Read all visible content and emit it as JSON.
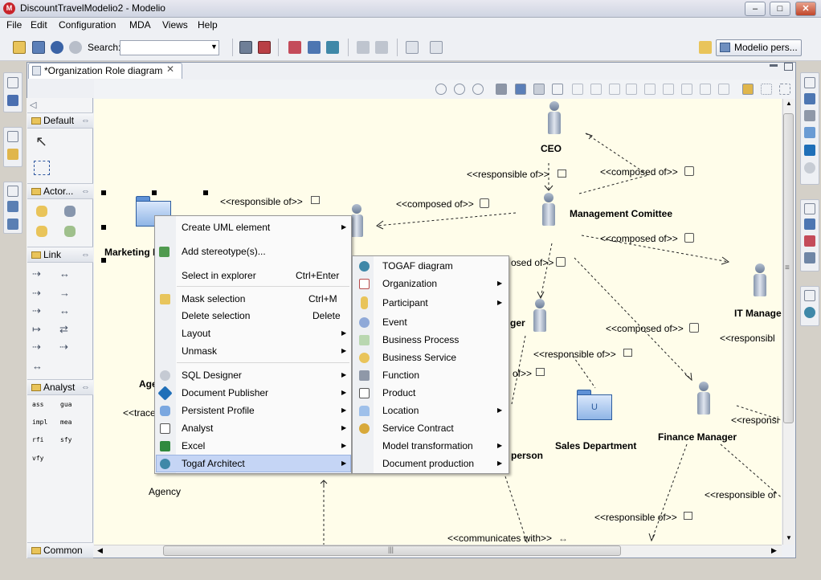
{
  "window": {
    "title": "DiscountTravelModelio2 - Modelio",
    "app_icon": "M"
  },
  "window_controls": {
    "minimize": "–",
    "maximize": "□",
    "close": "✕"
  },
  "menu": [
    "File",
    "Edit",
    "Configuration",
    "MDA",
    "Views",
    "Help"
  ],
  "toolbar": {
    "search_label": "Search:",
    "search_value": "",
    "perspective_label": "Modelio pers..."
  },
  "editor": {
    "tab_label": "*Organization Role diagram",
    "tab_close": "✕"
  },
  "palette": {
    "collapse_arrow": "◁",
    "groups": [
      {
        "label": "Default",
        "expand": "⇔"
      },
      {
        "label": "Actor...",
        "expand": "⇔"
      },
      {
        "label": "Link",
        "expand": "⇔"
      },
      {
        "label": "Analyst",
        "expand": "⇔"
      },
      {
        "label": "Common"
      }
    ],
    "stereotype_tools": [
      "ass",
      "gua",
      "impl",
      "mea",
      "rfi",
      "sfy",
      "vfy"
    ]
  },
  "diagram": {
    "nodes": {
      "ceo": "CEO",
      "management": "Management Comittee",
      "it_manager": "IT Manage",
      "finance": "Finance Manager",
      "sales": "Sales Department",
      "marketing": "Marketing I",
      "agency": "Agency",
      "age": "Age",
      "person": "person",
      "ger": "ger"
    },
    "folder_glyph": "U",
    "links": {
      "responsible_of": "<<responsible of>>",
      "composed_of": "<<composed of>>",
      "communicates_with": "<<communicates with>>",
      "trace": "<<trace",
      "responsibl": "<<responsibl",
      "responsi": "<<responsi",
      "responsible_o": "<<responsible of",
      "osed_of": "osed of>>",
      "of": "of>>"
    }
  },
  "context_menu": {
    "items": [
      {
        "label": "Create UML element",
        "submenu": true
      },
      {
        "label": "Add stereotype(s)...",
        "submenu": false
      },
      {
        "label": "Select in explorer",
        "shortcut": "Ctrl+Enter"
      },
      {
        "label": "Mask selection",
        "shortcut": "Ctrl+M"
      },
      {
        "label": "Delete selection",
        "shortcut": "Delete"
      },
      {
        "label": "Layout",
        "submenu": true
      },
      {
        "label": "Unmask",
        "submenu": true
      },
      {
        "label": "SQL Designer",
        "submenu": true
      },
      {
        "label": "Document Publisher",
        "submenu": true
      },
      {
        "label": "Persistent Profile",
        "submenu": true
      },
      {
        "label": "Analyst",
        "submenu": true
      },
      {
        "label": "Excel",
        "submenu": true
      },
      {
        "label": "Togaf Architect",
        "submenu": true
      }
    ]
  },
  "submenu": {
    "items": [
      {
        "label": "TOGAF diagram"
      },
      {
        "label": "Organization",
        "submenu": true
      },
      {
        "label": "Participant",
        "submenu": true
      },
      {
        "label": "Event"
      },
      {
        "label": "Business Process"
      },
      {
        "label": "Business Service"
      },
      {
        "label": "Function"
      },
      {
        "label": "Product"
      },
      {
        "label": "Location",
        "submenu": true
      },
      {
        "label": "Service Contract"
      },
      {
        "label": "Model transformation",
        "submenu": true
      },
      {
        "label": "Document production",
        "submenu": true
      }
    ]
  },
  "scrollbars": {
    "up": "▲",
    "down": "▼",
    "left": "◀",
    "right": "▶",
    "grip": "|||",
    "vgrip": "≡"
  },
  "colors": {
    "canvas": "#fffdea",
    "selection": "#c5d5f5",
    "brand": "#c8242b"
  }
}
